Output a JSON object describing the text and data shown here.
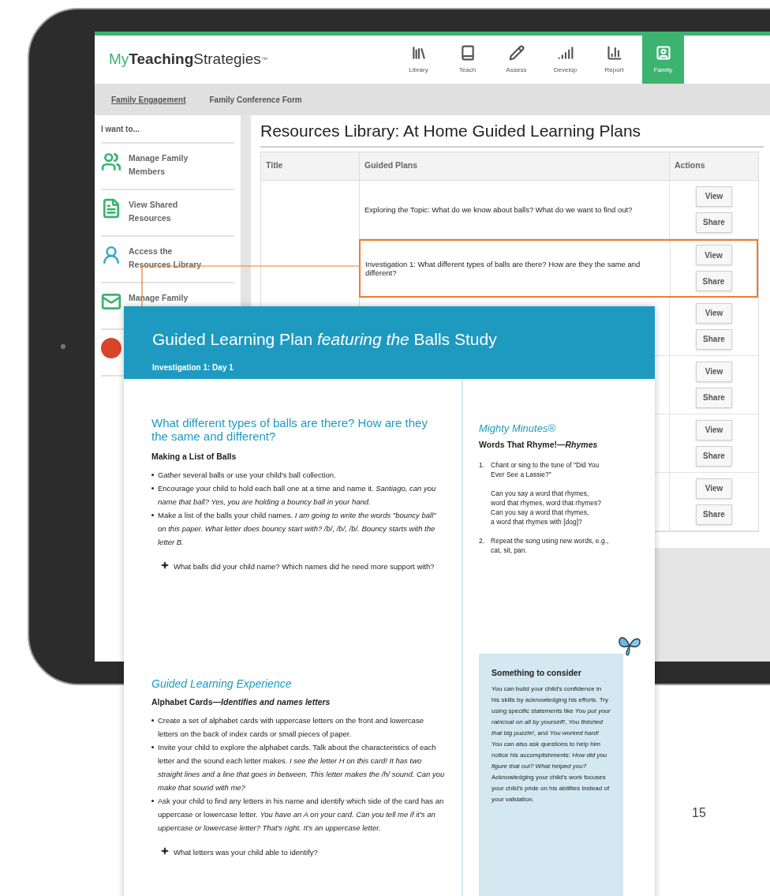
{
  "app": {
    "logo": [
      {
        "text": "My",
        "kind": "accent"
      },
      {
        "text": "Teaching",
        "kind": "bold"
      },
      {
        "text": "Strategies",
        "kind": "plain"
      },
      {
        "text": "™",
        "kind": "mark"
      }
    ],
    "nav": [
      {
        "label": "Library",
        "selected": false
      },
      {
        "label": "Teach",
        "selected": false
      },
      {
        "label": "Assess",
        "selected": false
      },
      {
        "label": "Develop",
        "selected": false
      },
      {
        "label": "Report",
        "selected": false
      },
      {
        "label": "Family",
        "selected": true
      }
    ],
    "subnav": [
      {
        "label": "Family Engagement",
        "selected": true
      },
      {
        "label": "Family Conference Form",
        "selected": false
      }
    ],
    "sidebar": {
      "heading": "I want to...",
      "items": [
        {
          "kind": "link",
          "label": "Manage Family Members"
        },
        {
          "kind": "link",
          "label": "View Shared Resources"
        },
        {
          "kind": "link",
          "label": "Access the Resources Library"
        },
        {
          "kind": "link",
          "label": "Manage Family"
        },
        {
          "kind": "avatar"
        }
      ]
    },
    "title": "Resources Library: At Home Guided Learning Plans",
    "table": {
      "columns": [
        "Title",
        "Guided Plans",
        "Actions"
      ],
      "rows": [
        {
          "plan": "Exploring the Topic: What do we know about balls? What do we want to find out?",
          "actions": [
            "View",
            "Share"
          ],
          "highlighted": false
        },
        {
          "plan": "Investigation 1: What different types of balls are there? How are they the same and different?",
          "actions": [
            "View",
            "Share"
          ],
          "highlighted": true
        },
        {
          "actions": [
            "View",
            "Share"
          ],
          "highlighted": false
        },
        {
          "actions": [
            "View",
            "Share"
          ],
          "highlighted": false
        },
        {
          "actions": [
            "View",
            "Share"
          ],
          "highlighted": false
        },
        {
          "actions": [
            "View",
            "Share"
          ],
          "highlighted": false
        }
      ]
    }
  },
  "document": {
    "title": "Guided Learning Plan *featuring the* Balls Study",
    "subtitle": "Investigation 1: Day 1",
    "main": {
      "heading": "What different types of balls are there? How are they the same and different?",
      "subheading": "Making a List of Balls",
      "bullets": [
        "Gather several balls or use your child's ball collection.",
        "Encourage your child to hold each ball one at a time and name it. *Santiago, can you name that ball? Yes, you are holding a bouncy ball in your hand.*",
        "Make a list of the balls your child names. *I am going to write the words \"bouncy ball\" on this paper. What letter does bouncy start with? /b/, /b/, /b/. Bouncy starts with the letter B.*"
      ],
      "question": "What balls did your child name? Which names did he need more support with?"
    },
    "experience": {
      "heading": "Guided Learning Experience",
      "subheading": "Alphabet Cards—*Identifies and names letters*",
      "bullets": [
        "Create a set of alphabet cards with uppercase letters on the front and lowercase letters on the back of index cards or small pieces of paper.",
        "Invite your child to explore the alphabet cards. Talk about the characteristics of each letter and the sound each letter makes. *I see the letter H on this card! It has two straight lines and a line that goes in between. This letter makes the /h/ sound. Can you make that sound with me?*",
        "Ask your child to find any letters in his name and identify which side of the card has an uppercase or lowercase letter. *You have an A on your card. Can you tell me if it's an uppercase or lowercase letter? That's right. It's an uppercase letter.*"
      ],
      "question": "What letters was your child able to identify?"
    },
    "mighty": {
      "heading": "Mighty Minutes®",
      "subheading": "Words That Rhyme!—*Rhymes*",
      "steps": [
        {
          "number": "1.",
          "text": "Chant or sing to the tune of \"Did You Ever See a Lassie?\"",
          "verse": "Can you say a word that rhymes,\nword that rhymes, word that rhymes?\nCan you say a word that rhymes,\na word that rhymes with [dog]?"
        },
        {
          "number": "2.",
          "text": "Repeat the song using new words, e.g., cat, sit, pan."
        }
      ]
    },
    "consider": {
      "heading": "Something to consider",
      "text": "You can build your child's confidence in his skills by acknowledging his efforts. Try using specific statements like *You put your raincoat on all by yourself!*, *You finished that big puzzle!*, and *You worked hard!* You can also ask questions to help him notice his accomplishments: *How did you figure that out? What helped you?* Acknowledging your child's work focuses your child's pride on his abilities instead of your validation."
    }
  },
  "page_number": "15"
}
